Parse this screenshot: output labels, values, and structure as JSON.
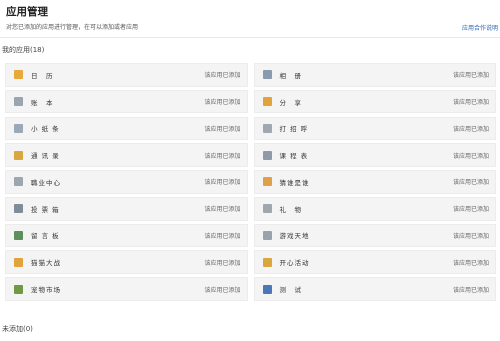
{
  "page": {
    "title": "应用管理",
    "description": "对您已添加的应用进行管理，在可以添加或者应用",
    "top_right_link": "应用合作说明"
  },
  "added_section": {
    "label": "我的应用(18)"
  },
  "pending_section": {
    "label": "未添加(0)"
  },
  "apps": [
    {
      "name": "日　历",
      "status": "该应用已添加",
      "icon": "calendar-icon",
      "color": "#e8a93a"
    },
    {
      "name": "相　册",
      "status": "该应用已添加",
      "icon": "album-icon",
      "color": "#8a9bb0"
    },
    {
      "name": "账　本",
      "status": "该应用已添加",
      "icon": "ledger-icon",
      "color": "#9aa5b2"
    },
    {
      "name": "分　享",
      "status": "该应用已添加",
      "icon": "share-icon",
      "color": "#e2a23c"
    },
    {
      "name": "小 纸 条",
      "status": "该应用已添加",
      "icon": "note-icon",
      "color": "#9aa9b8"
    },
    {
      "name": "打 招 呼",
      "status": "该应用已添加",
      "icon": "greeting-icon",
      "color": "#a0a8b2"
    },
    {
      "name": "通 讯 录",
      "status": "该应用已添加",
      "icon": "contacts-icon",
      "color": "#d9a640"
    },
    {
      "name": "课 程 表",
      "status": "该应用已添加",
      "icon": "schedule-icon",
      "color": "#8f9aa8"
    },
    {
      "name": "職业中心",
      "status": "该应用已添加",
      "icon": "career-icon",
      "color": "#9ea6b0"
    },
    {
      "name": "猜谁是谁",
      "status": "该应用已添加",
      "icon": "guess-icon",
      "color": "#e0a04a"
    },
    {
      "name": "投 票 箱",
      "status": "该应用已添加",
      "icon": "vote-icon",
      "color": "#7f8c99"
    },
    {
      "name": "礼　物",
      "status": "该应用已添加",
      "icon": "gift-icon",
      "color": "#a0a6ae"
    },
    {
      "name": "留 言 板",
      "status": "该应用已添加",
      "icon": "message-board-icon",
      "color": "#5e8f5a"
    },
    {
      "name": "游戏天地",
      "status": "该应用已添加",
      "icon": "games-icon",
      "color": "#9aa3ad"
    },
    {
      "name": "猫猫大战",
      "status": "该应用已添加",
      "icon": "cat-battle-icon",
      "color": "#e2a23c"
    },
    {
      "name": "开心活动",
      "status": "该应用已添加",
      "icon": "activity-icon",
      "color": "#d9a640"
    },
    {
      "name": "宠物市场",
      "status": "该应用已添加",
      "icon": "pet-market-icon",
      "color": "#6e9a45"
    },
    {
      "name": "测　试",
      "status": "该应用已添加",
      "icon": "test-icon",
      "color": "#4a78b8"
    }
  ]
}
